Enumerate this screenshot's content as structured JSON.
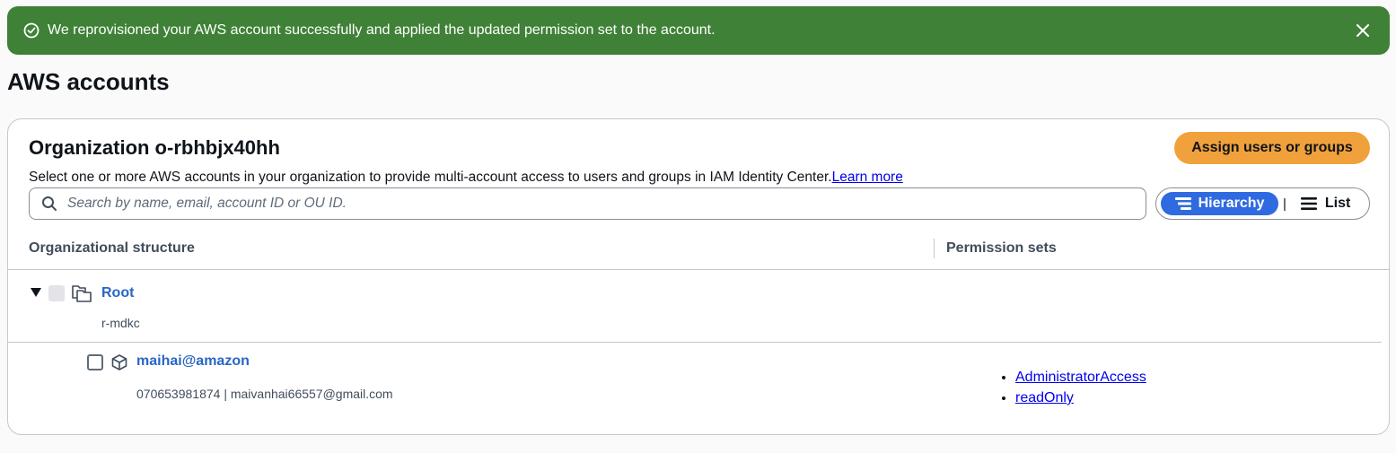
{
  "flash": {
    "message": "We reprovisioned your AWS account successfully and applied the updated permission set to the account.",
    "type": "success",
    "color": "#3f8137"
  },
  "page": {
    "title": "AWS accounts"
  },
  "organization": {
    "title": "Organization o-rbhbjx40hh",
    "assign_button": "Assign users or groups",
    "description": "Select one or more AWS accounts in your organization to provide multi-account access to users and groups in IAM Identity Center.",
    "learn_more": "Learn more",
    "search_placeholder": "Search by name, email, account ID or OU ID.",
    "view_toggle": {
      "hierarchy": "Hierarchy",
      "separator": "|",
      "list": "List",
      "selected": "Hierarchy"
    }
  },
  "table": {
    "headers": {
      "structure": "Organizational structure",
      "permissions": "Permission sets"
    },
    "root": {
      "name": "Root",
      "id": "r-mdkc",
      "expanded": true
    },
    "accounts": [
      {
        "name": "maihai@amazon",
        "meta": "070653981874  |  maivanhai66557@gmail.com",
        "permission_sets": [
          "AdministratorAccess",
          "readOnly"
        ]
      }
    ]
  },
  "colors": {
    "link": "#2866c4",
    "primary_button": "#f0a13b",
    "toggle_active": "#2f6ae0"
  }
}
